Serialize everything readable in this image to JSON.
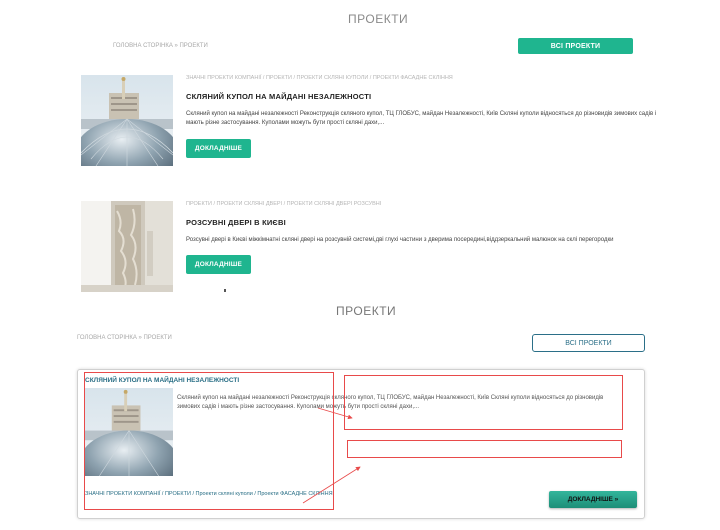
{
  "top": {
    "title": "ПРОЕКТИ",
    "breadcrumb": "ГОЛОВНА СТОРІНКА » ПРОЕКТИ",
    "all_projects": "ВСІ ПРОЕКТИ",
    "projects": [
      {
        "categories": "ЗНАЧНІ ПРОЕКТИ КОМПАНІЇ / ПРОЕКТИ / ПРОЕКТИ СКЛЯНІ КУПОЛИ / ПРОЕКТИ ФАСАДНЕ СКЛІННЯ",
        "title": "СКЛЯНИЙ КУПОЛ НА МАЙДАНІ НЕЗАЛЕЖНОСТІ",
        "description": "Скляний купол на майдані незалежності Реконструкція скляного купол, ТЦ ГЛОБУС, майдан Незалежності, Київ Скляні куполи відносяться до різновидів зимових садів і мають різне застосування. Куполами можуть бути прості скляні дахи,...",
        "button": "ДОКЛАДНІШЕ"
      },
      {
        "categories": "ПРОЕКТИ / ПРОЕКТИ СКЛЯНІ ДВЕРІ / ПРОЕКТИ СКЛЯНІ ДВЕРІ РОЗСУВНІ",
        "title": "РОЗСУВНІ ДВЕРІ В КИЄВІ",
        "description": "Розсувні двері в Києві міжкімнатні скляні двері на розсувній системі,дві глухі частини з дверима посередині,віддзеркальний малюнок на склі перегородки",
        "button": "ДОКЛАДНІШЕ"
      }
    ]
  },
  "bottom": {
    "title": "ПРОЕКТИ",
    "breadcrumb": "ГОЛОВНА СТОРІНКА » ПРОЕКТИ",
    "all_projects": "ВСІ ПРОЕКТИ",
    "card": {
      "title": "СКЛЯНИЙ КУПОЛ НА МАЙДАНІ НЕЗАЛЕЖНОСТІ",
      "description": "Скляний купол на майдані незалежності Реконструкція скляного купол, ТЦ ГЛОБУС, майдан Незалежності, Київ Скляні куполи відносяться до різновидів зимових садів і мають різне застосування. Куполами можуть бути прості скляні дахи,...",
      "categories": "ЗНАЧНІ ПРОЕКТИ КОМПАНІЇ / ПРОЕКТИ / Проекти скляні куполи / Проекти ФАСАДНЕ СКЛІННЯ",
      "button": "ДОКЛАДНІШЕ »"
    }
  },
  "colors": {
    "green": "#1fb58f",
    "teal": "#2a6f86",
    "annotation_red": "#e84a4a"
  }
}
